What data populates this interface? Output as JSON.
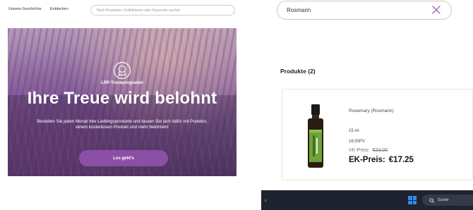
{
  "left": {
    "nav": {
      "story": "Unsere Geschichte",
      "discover": "Entdecken"
    },
    "search_placeholder": "Nach Produkten, Kollektionen oder Keywords suchen",
    "hero": {
      "program": "LRP-Treueprogramm",
      "title": "Ihre Treue wird belohnt",
      "text": "Bestellen Sie jeden Monat Ihre Lieblingsprodukte und lassen Sie sich dafür mit Punkten, einem kostenlosen Produkt und mehr belohnen!",
      "button": "Los geht's"
    }
  },
  "right": {
    "search_value": "Rosmarin",
    "products_heading": "Produkte (2)",
    "product": {
      "name": "Rosemary (Rosmarin)",
      "size": "15 ml",
      "pv": "16.50PV",
      "vk_label": "VK-Preis:",
      "vk_price": "€23.00",
      "ek_label": "EK-Preis:",
      "ek_price": "€17.25"
    },
    "taskbar": {
      "search": "Suche",
      "dot": "s"
    }
  },
  "colors": {
    "accent_purple": "#8b4fa6",
    "close_purple": "#9b6ab8",
    "taskbar": "#1f2330",
    "windows_blue": "#2f8cf0"
  },
  "icons": [
    "search-icon",
    "close-icon",
    "loyalty-badge-icon",
    "windows-start-icon",
    "product-bottle-image"
  ]
}
